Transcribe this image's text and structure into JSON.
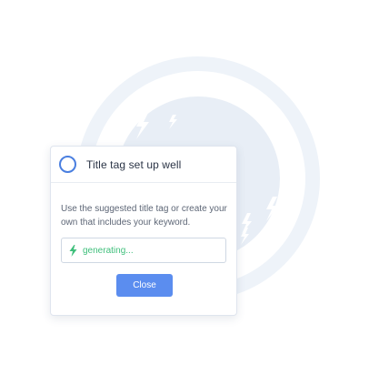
{
  "card": {
    "title": "Title tag set up well",
    "description": "Use the suggested title tag or create your own that includes your keyword.",
    "status_field": {
      "icon": "lightning-bolt-icon",
      "text": "generating..."
    },
    "close_label": "Close"
  },
  "background": {
    "icons": [
      "lightning-bolt-icon"
    ]
  },
  "colors": {
    "accent_blue": "#5b8def",
    "ring_blue": "#4a7fe0",
    "generating_green": "#3fbf7b",
    "background_art": "#e8eef6"
  }
}
